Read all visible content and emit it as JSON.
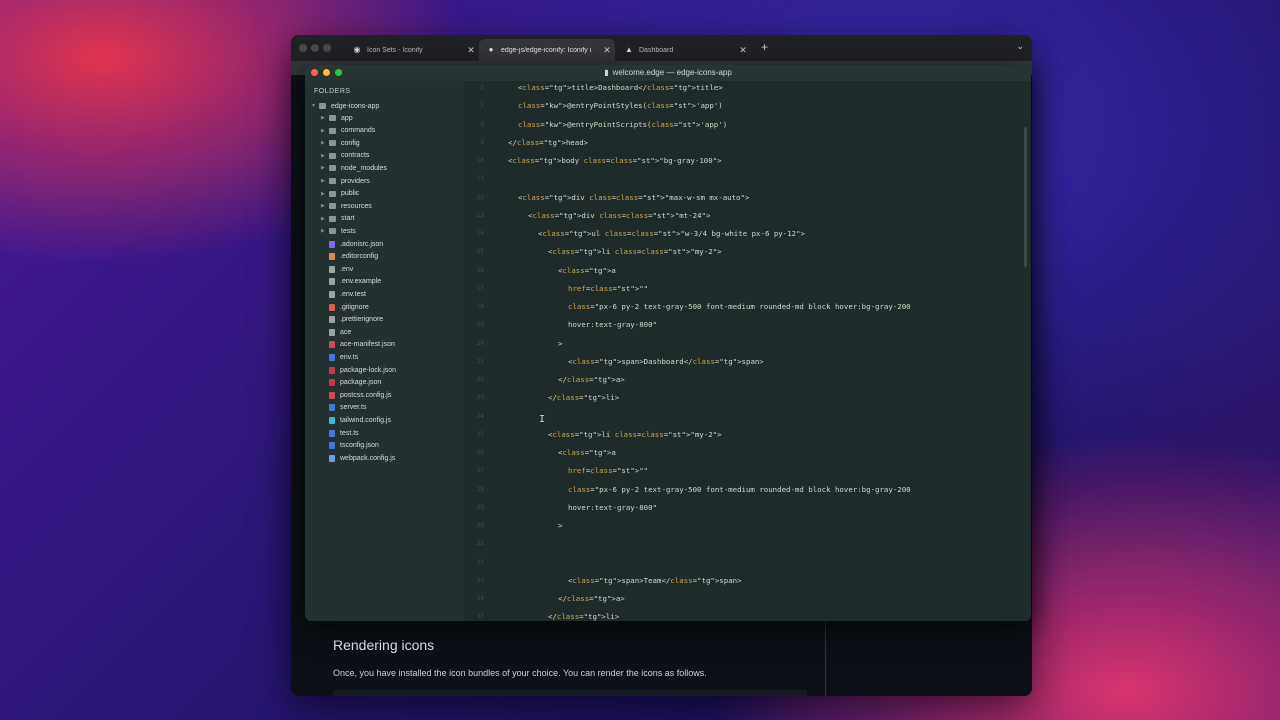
{
  "browser": {
    "tabs": [
      {
        "label": "Icon Sets - Iconify",
        "icon": "globe-icon"
      },
      {
        "label": "edge-js/edge-iconify: Iconify i",
        "icon": "github-icon"
      },
      {
        "label": "Dashboard",
        "icon": "triangle-icon"
      }
    ],
    "new_tab": "+",
    "page": {
      "heading": "Rendering icons",
      "text": "Once, you have installed the icon bundles of your choice. You can render the icons as follows."
    }
  },
  "editor": {
    "title": "welcome.edge — edge-icons-app",
    "sidebar": {
      "header": "FOLDERS",
      "root": "edge-icons-app",
      "folders": [
        "app",
        "commands",
        "config",
        "contracts",
        "node_modules",
        "providers",
        "public",
        "resources",
        "start",
        "tests"
      ],
      "files": [
        {
          "name": ".adonisrc.json",
          "color": "#7b6cf0"
        },
        {
          "name": ".editorconfig",
          "color": "#e08a3c"
        },
        {
          "name": ".env",
          "color": "#9aa6a6"
        },
        {
          "name": ".env.example",
          "color": "#9aa6a6"
        },
        {
          "name": ".env.test",
          "color": "#9aa6a6"
        },
        {
          "name": ".gitignore",
          "color": "#e05d44"
        },
        {
          "name": ".prettierignore",
          "color": "#9aa6a6"
        },
        {
          "name": "ace",
          "color": "#9aa6a6"
        },
        {
          "name": "ace-manifest.json",
          "color": "#d0475c"
        },
        {
          "name": "env.ts",
          "color": "#3d7ae0"
        },
        {
          "name": "package-lock.json",
          "color": "#c8364a"
        },
        {
          "name": "package.json",
          "color": "#c8364a"
        },
        {
          "name": "postcss.config.js",
          "color": "#d0475c"
        },
        {
          "name": "server.ts",
          "color": "#3d7ae0"
        },
        {
          "name": "tailwind.config.js",
          "color": "#3db8d0"
        },
        {
          "name": "test.ts",
          "color": "#3d7ae0"
        },
        {
          "name": "tsconfig.json",
          "color": "#3d7ae0"
        },
        {
          "name": "webpack.config.js",
          "color": "#6aa0e0"
        }
      ]
    },
    "code_lines": [
      "<title>Dashboard</title>",
      "@entryPointStyles('app')",
      "@entryPointScripts('app')",
      "</head>",
      "<body class=\"bg-gray-100\">",
      "",
      "<div class=\"max-w-sm mx-auto\">",
      "<div class=\"mt-24\">",
      "<ul class=\"w-3/4 bg-white px-6 py-12\">",
      "<li class=\"my-2\">",
      "<a",
      "href=\"\"",
      "class=\"px-6 py-2 text-gray-500 font-medium rounded-md block hover:bg-gray-200",
      "hover:text-gray-800\"",
      ">",
      "<span>Dashboard</span>",
      "</a>",
      "</li>",
      "",
      "<li class=\"my-2\">",
      "<a",
      "href=\"\"",
      "class=\"px-6 py-2 text-gray-500 font-medium rounded-md block hover:bg-gray-200",
      "hover:text-gray-800\"",
      ">",
      "",
      "",
      "<span>Team</span>",
      "</a>",
      "</li>"
    ]
  }
}
